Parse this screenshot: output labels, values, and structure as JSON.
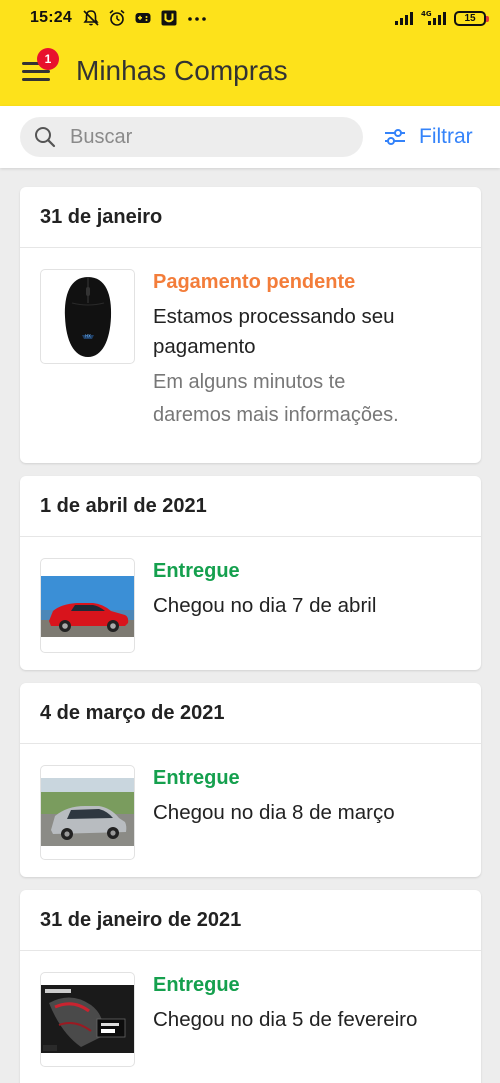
{
  "status_bar": {
    "time": "15:24",
    "battery": "15"
  },
  "header": {
    "title": "Minhas Compras",
    "notification_count": "1"
  },
  "search": {
    "placeholder": "Buscar",
    "filter_label": "Filtrar"
  },
  "colors": {
    "brand_yellow": "#fde21b",
    "accent_blue": "#3483fa",
    "pending_orange": "#f37d3a",
    "delivered_green": "#15a04e"
  },
  "orders": [
    {
      "date": "31 de janeiro",
      "status": "Pagamento pendente",
      "line1": "Estamos processando seu",
      "line2": "pagamento",
      "note1": "Em alguns minutos te",
      "note2": "daremos mais informações.",
      "image": "mouse"
    },
    {
      "date": "1 de abril de 2021",
      "status": "Entregue",
      "line1": "Chegou no dia 7 de abril",
      "image": "red-car"
    },
    {
      "date": "4 de março de 2021",
      "status": "Entregue",
      "line1": "Chegou no dia 8 de março",
      "image": "silver-car"
    },
    {
      "date": "31 de janeiro de 2021",
      "status": "Entregue",
      "line1": "Chegou no dia 5 de fevereiro",
      "image": "gpu-box"
    }
  ]
}
